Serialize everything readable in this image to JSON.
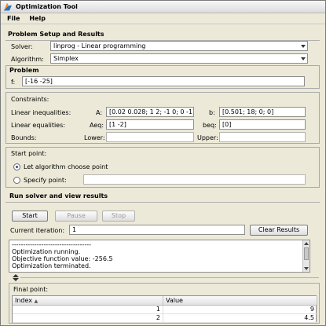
{
  "window": {
    "title": "Optimization Tool"
  },
  "menu": {
    "file": "File",
    "help": "Help"
  },
  "setup": {
    "heading": "Problem Setup and Results",
    "solver_label": "Solver:",
    "solver_value": "linprog - Linear programming",
    "algorithm_label": "Algorithm:",
    "algorithm_value": "Simplex"
  },
  "problem": {
    "heading": "Problem",
    "f_label": "f:",
    "f_value": "[-16 -25]"
  },
  "constraints": {
    "heading": "Constraints:",
    "lin_ineq_label": "Linear inequalities:",
    "A_label": "A:",
    "A_value": "[0.02 0.028; 1 2; -1 0; 0 -1]",
    "b_label": "b:",
    "b_value": "[0.501; 18; 0; 0]",
    "lin_eq_label": "Linear equalities:",
    "Aeq_label": "Aeq:",
    "Aeq_value": "[1 -2]",
    "beq_label": "beq:",
    "beq_value": "[0]",
    "bounds_label": "Bounds:",
    "lower_label": "Lower:",
    "lower_value": "",
    "upper_label": "Upper:",
    "upper_value": ""
  },
  "start_point": {
    "heading": "Start point:",
    "option_auto": "Let algorithm choose point",
    "option_specify": "Specify point:",
    "selected": "auto",
    "point_value": ""
  },
  "run": {
    "heading": "Run solver and view results",
    "start_label": "Start",
    "pause_label": "Pause",
    "stop_label": "Stop",
    "iteration_label": "Current iteration:",
    "iteration_value": "1",
    "clear_label": "Clear Results"
  },
  "log": {
    "lines": [
      "-----------------------------------",
      "Optimization running.",
      "Objective function value: -256.5",
      "Optimization terminated."
    ]
  },
  "final_point": {
    "heading": "Final point:",
    "columns": [
      "Index",
      "Value"
    ],
    "rows": [
      {
        "index": "1",
        "value": "9"
      },
      {
        "index": "2",
        "value": "4.5"
      }
    ]
  },
  "colors": {
    "window_bg": "#ece9d8",
    "radio_dot": "#2b4f9e"
  }
}
